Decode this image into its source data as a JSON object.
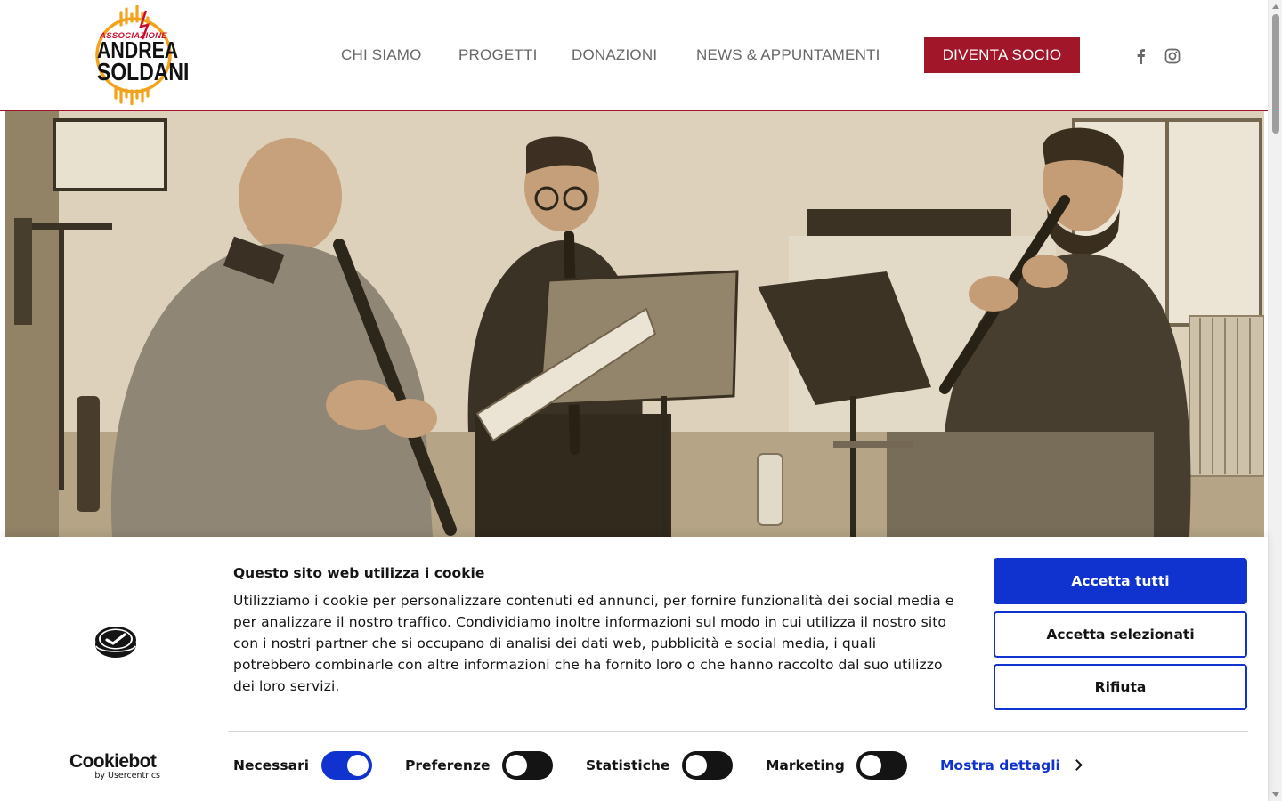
{
  "header": {
    "logo": {
      "small": "ASSOCIAZIONE",
      "line1": "ANDREA",
      "line2": "SOLDANI"
    },
    "nav": [
      {
        "label": "CHI SIAMO"
      },
      {
        "label": "PROGETTI"
      },
      {
        "label": "DONAZIONI"
      },
      {
        "label": "NEWS & APPUNTAMENTI"
      }
    ],
    "cta_label": "DIVENTA SOCIO",
    "social_icons": [
      "facebook-icon",
      "instagram-icon"
    ]
  },
  "colors": {
    "brand_red": "#a2162a",
    "cookie_blue": "#1032cf",
    "logo_orange": "#f2a21b"
  },
  "cookie": {
    "title": "Questo sito web utilizza i cookie",
    "text": "Utilizziamo i cookie per personalizzare contenuti ed annunci, per fornire funzionalità dei social media e per analizzare il nostro traffico. Condividiamo inoltre informazioni sul modo in cui utilizza il nostro sito con i nostri partner che si occupano di analisi dei dati web, pubblicità e social media, i quali potrebbero combinarle con altre informazioni che ha fornito loro o che hanno raccolto dal suo utilizzo dei loro servizi.",
    "accept_all": "Accetta tutti",
    "accept_selected": "Accetta selezionati",
    "reject": "Rifiuta",
    "brand": "Cookiebot",
    "brand_sub": "by Usercentrics",
    "toggles": [
      {
        "label": "Necessari",
        "on": true
      },
      {
        "label": "Preferenze",
        "on": false
      },
      {
        "label": "Statistiche",
        "on": false
      },
      {
        "label": "Marketing",
        "on": false
      }
    ],
    "details_label": "Mostra dettagli"
  }
}
